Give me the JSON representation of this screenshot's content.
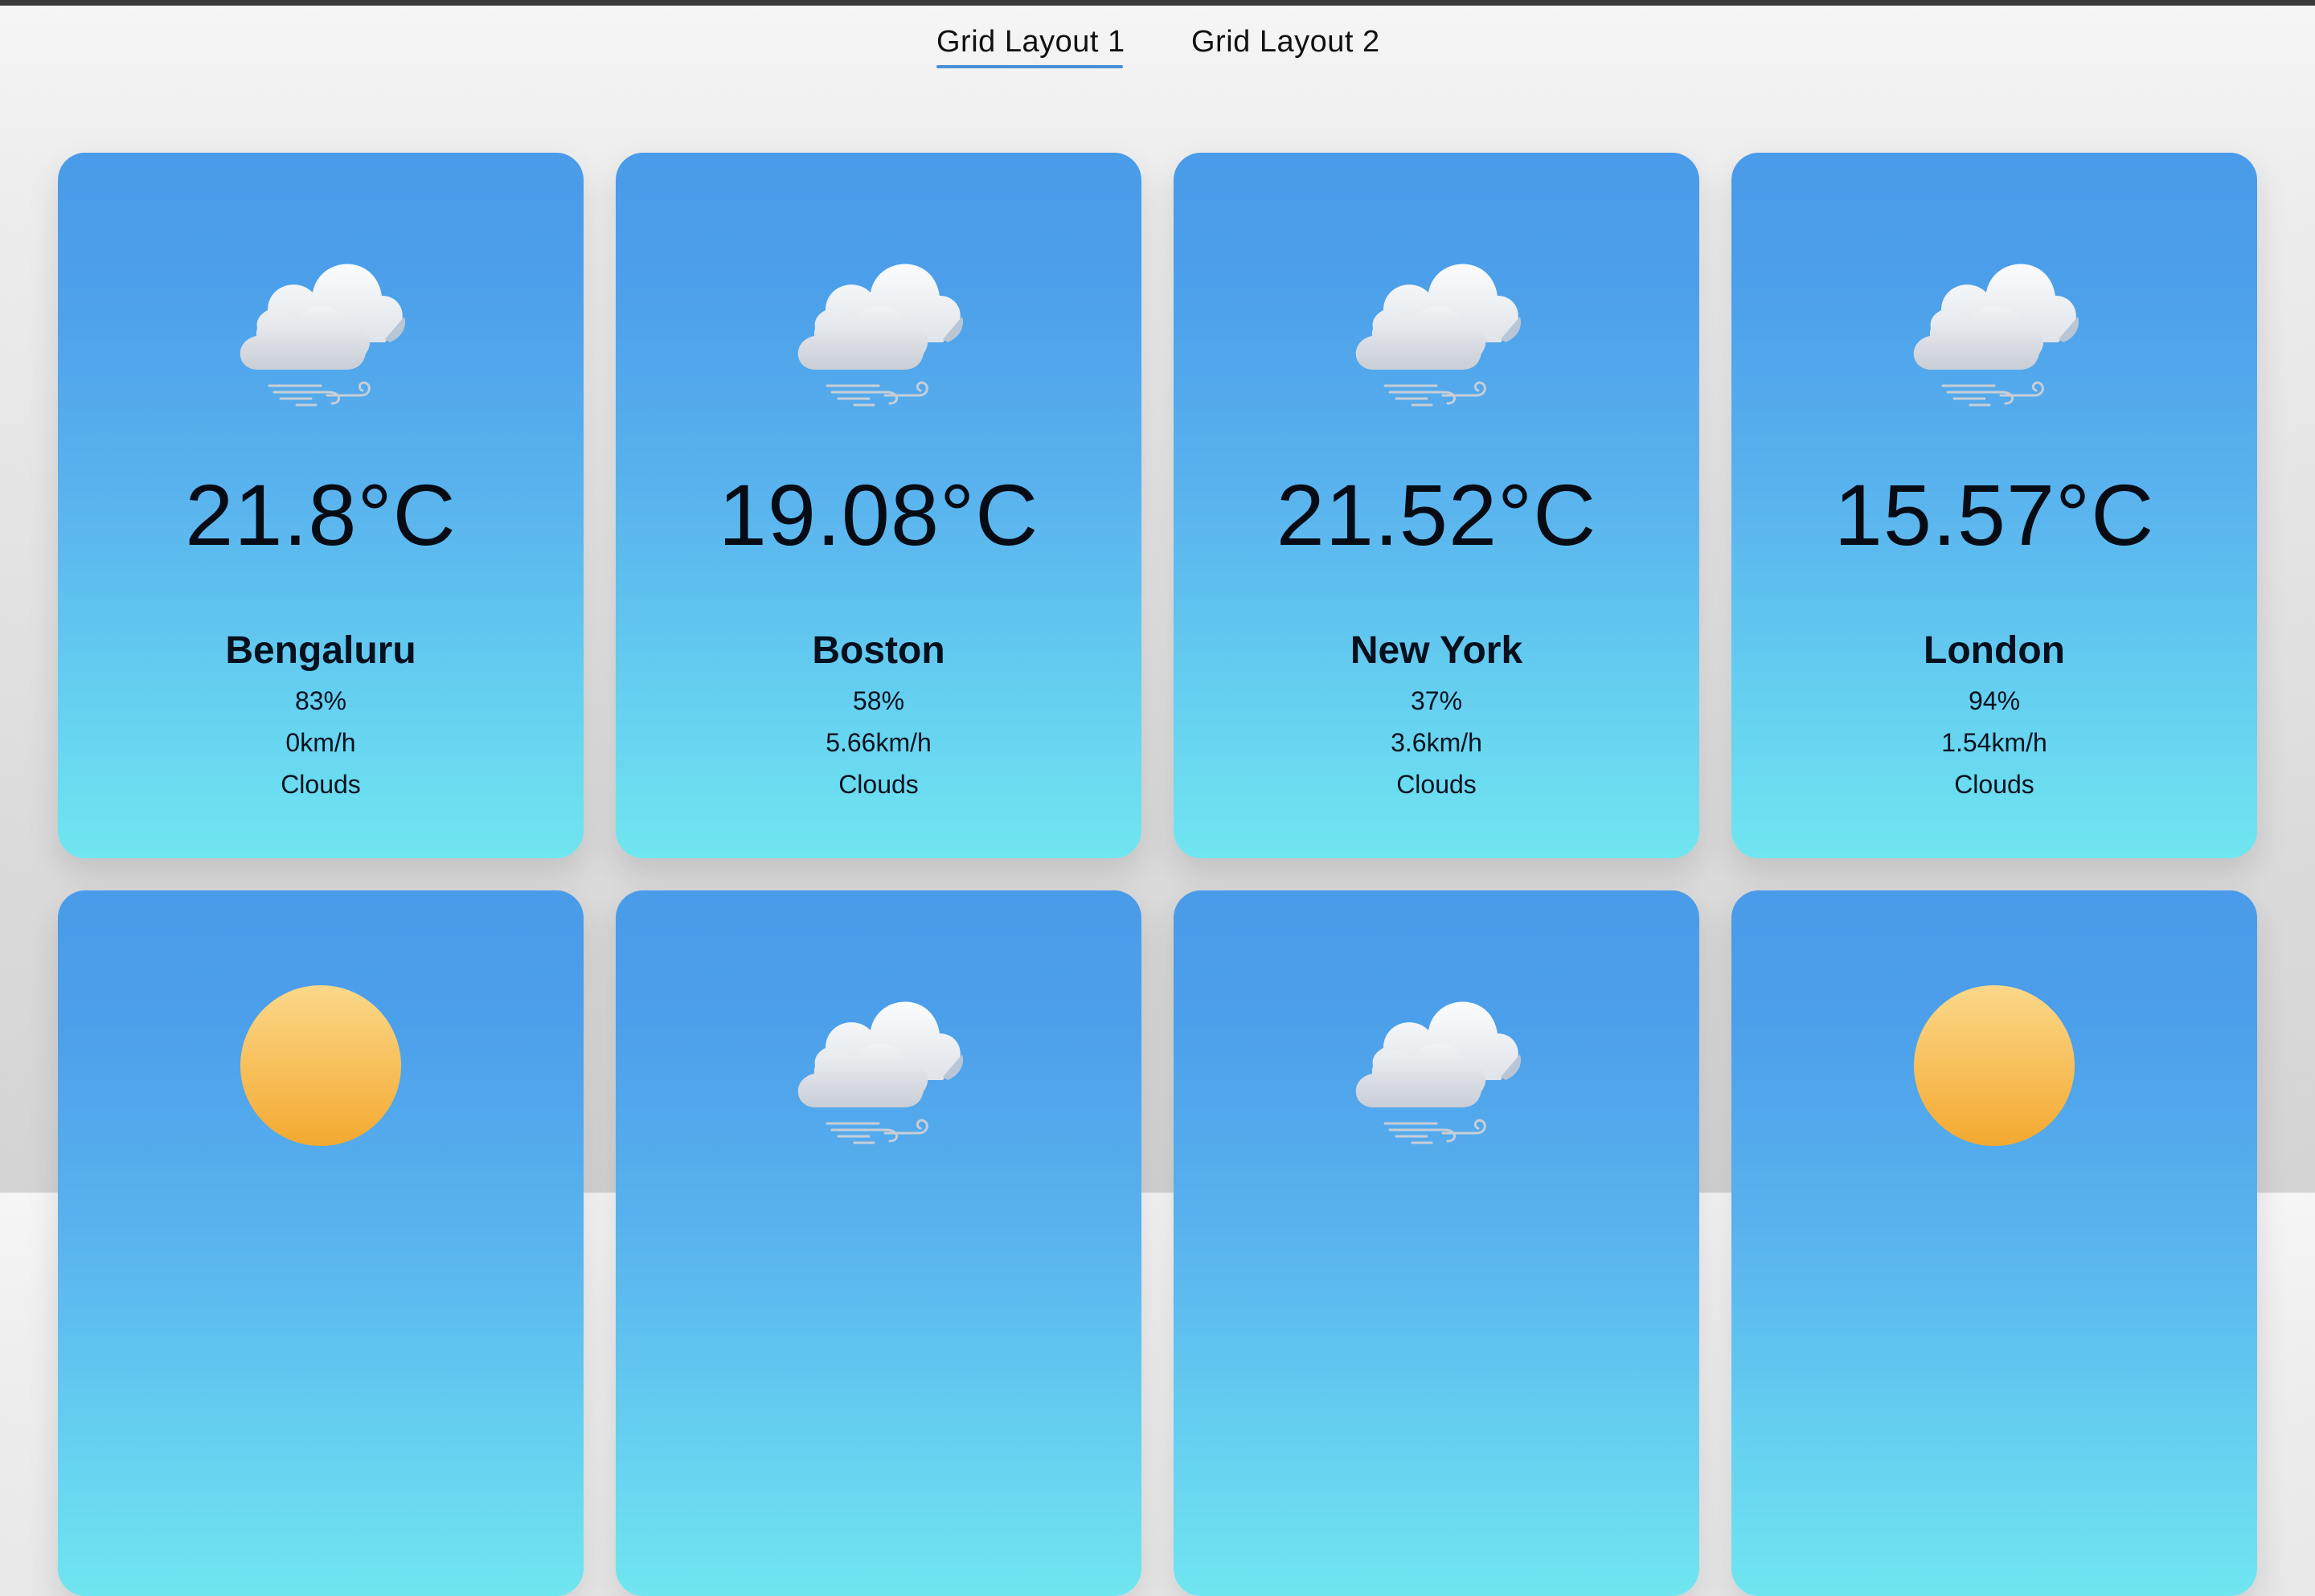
{
  "tabs": [
    {
      "label": "Grid Layout 1",
      "active": true
    },
    {
      "label": "Grid Layout 2",
      "active": false
    }
  ],
  "cards": [
    {
      "temp": "21.8°C",
      "city": "Bengaluru",
      "humidity": "83%",
      "wind": "0km/h",
      "condition": "Clouds",
      "icon": "cloud-wind-icon"
    },
    {
      "temp": "19.08°C",
      "city": "Boston",
      "humidity": "58%",
      "wind": "5.66km/h",
      "condition": "Clouds",
      "icon": "cloud-wind-icon"
    },
    {
      "temp": "21.52°C",
      "city": "New York",
      "humidity": "37%",
      "wind": "3.6km/h",
      "condition": "Clouds",
      "icon": "cloud-wind-icon"
    },
    {
      "temp": "15.57°C",
      "city": "London",
      "humidity": "94%",
      "wind": "1.54km/h",
      "condition": "Clouds",
      "icon": "cloud-wind-icon"
    },
    {
      "temp": "",
      "city": "",
      "humidity": "",
      "wind": "",
      "condition": "",
      "icon": "sun-icon"
    },
    {
      "temp": "",
      "city": "",
      "humidity": "",
      "wind": "",
      "condition": "",
      "icon": "cloud-wind-icon"
    },
    {
      "temp": "",
      "city": "",
      "humidity": "",
      "wind": "",
      "condition": "",
      "icon": "cloud-wind-icon"
    },
    {
      "temp": "",
      "city": "",
      "humidity": "",
      "wind": "",
      "condition": "",
      "icon": "sun-icon"
    }
  ],
  "colors": {
    "tab_underline": "#4a8fd6",
    "card_top": "#4a9be9",
    "card_bottom": "#70e6f0",
    "sun": "#f6b73c"
  }
}
